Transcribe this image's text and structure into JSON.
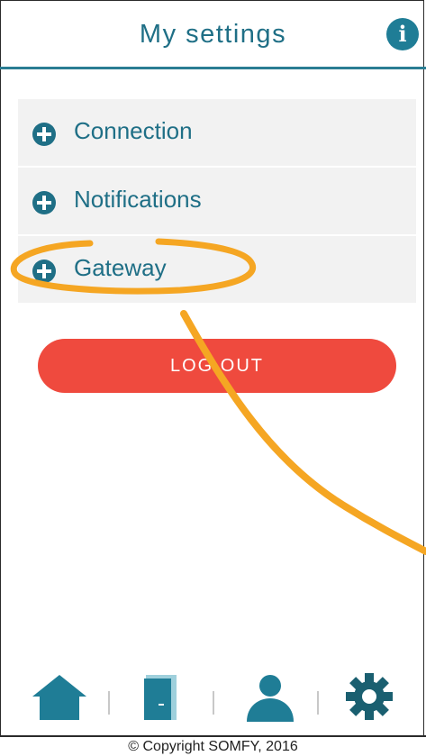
{
  "header": {
    "title": "My settings",
    "info_label": "i"
  },
  "menu": {
    "items": [
      {
        "label": "Connection"
      },
      {
        "label": "Notifications"
      },
      {
        "label": "Gateway"
      }
    ]
  },
  "logout_label": "LOG OUT",
  "tabbar": {
    "tabs": [
      {
        "icon": "home-icon"
      },
      {
        "icon": "door-icon"
      },
      {
        "icon": "user-icon"
      },
      {
        "icon": "gear-icon"
      }
    ]
  },
  "footer": {
    "copyright": "© Copyright SOMFY, 2016"
  },
  "colors": {
    "primary": "#1f6f86",
    "logout": "#ef4a3e",
    "highlight": "#f5a623",
    "menu_bg": "#f2f2f2"
  }
}
